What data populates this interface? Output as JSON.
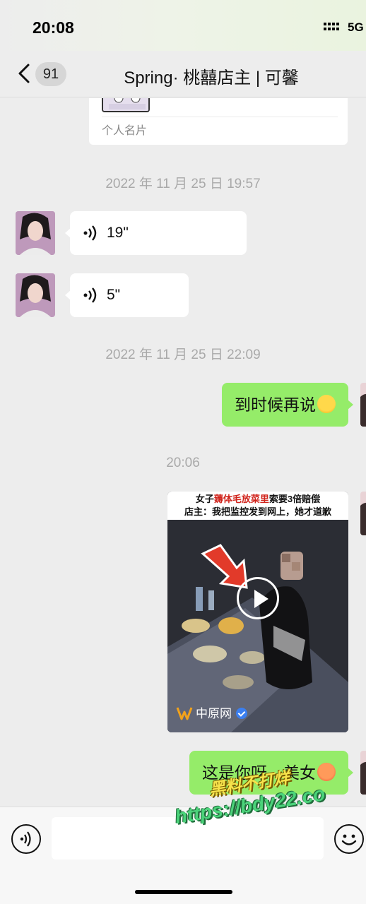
{
  "status_bar": {
    "time": "20:08",
    "network": "5G"
  },
  "nav": {
    "unread_count": "91",
    "title": "Spring· 桃囍店主 | 可馨"
  },
  "chat": {
    "card": {
      "label": "个人名片"
    },
    "timestamp_1": "2022 年 11 月 25 日 19:57",
    "voice_messages": [
      {
        "duration": "19\""
      },
      {
        "duration": "5\""
      }
    ],
    "timestamp_2": "2022 年 11 月 25 日 22:09",
    "outgoing_1": {
      "text": "到时候再说",
      "emoji": "crying-laughing-emoji"
    },
    "timestamp_3": "20:06",
    "video": {
      "headline_prefix": "女子",
      "headline_highlight": "薅体毛放菜里",
      "headline_suffix": "索要3倍赔偿",
      "subheadline": "店主：我把监控发到网上，她才道歉",
      "source": "中原网"
    },
    "outgoing_2": {
      "text": "这是你呀，美女",
      "emoji": "sweating-angry-emoji"
    }
  },
  "watermark": {
    "line1": "黑料不打烊",
    "line2": "https://bdy22.co"
  },
  "colors": {
    "outgoing_bubble": "#95ec69",
    "incoming_bubble": "#ffffff",
    "background": "#ededed",
    "highlight_red": "#d0231b"
  }
}
